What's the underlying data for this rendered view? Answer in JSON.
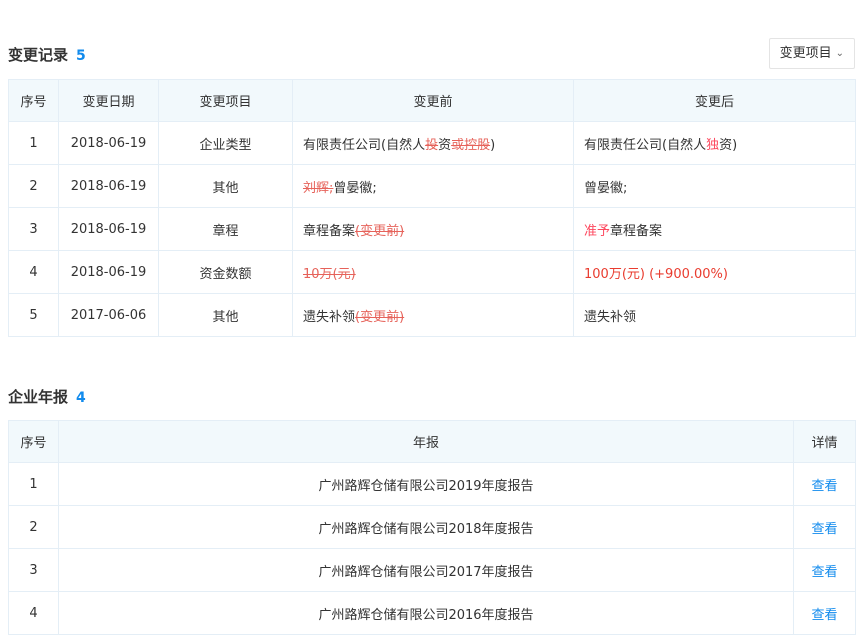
{
  "changes": {
    "title": "变更记录",
    "count": "5",
    "filter_label": "变更项目",
    "headers": [
      "序号",
      "变更日期",
      "变更项目",
      "变更前",
      "变更后"
    ],
    "rows": [
      {
        "no": "1",
        "date": "2018-06-19",
        "item": "企业类型",
        "before": [
          {
            "t": "有限责任公司(自然人",
            "s": "n"
          },
          {
            "t": "投",
            "s": "del"
          },
          {
            "t": "资",
            "s": "n"
          },
          {
            "t": "或控股",
            "s": "del"
          },
          {
            "t": ")",
            "s": "n"
          }
        ],
        "after": [
          {
            "t": "有限责任公司(自然人",
            "s": "n"
          },
          {
            "t": "独",
            "s": "add"
          },
          {
            "t": "资)",
            "s": "n"
          }
        ]
      },
      {
        "no": "2",
        "date": "2018-06-19",
        "item": "其他",
        "before": [
          {
            "t": "刘辉;",
            "s": "del"
          },
          {
            "t": "曾晏徽;",
            "s": "n"
          }
        ],
        "after": [
          {
            "t": "曾晏徽;",
            "s": "n"
          }
        ]
      },
      {
        "no": "3",
        "date": "2018-06-19",
        "item": "章程",
        "before": [
          {
            "t": "章程备案",
            "s": "n"
          },
          {
            "t": "(变更前)",
            "s": "del"
          }
        ],
        "after": [
          {
            "t": "准予",
            "s": "add"
          },
          {
            "t": "章程备案",
            "s": "n"
          }
        ]
      },
      {
        "no": "4",
        "date": "2018-06-19",
        "item": "资金数额",
        "before": [
          {
            "t": "10万(元)",
            "s": "del"
          }
        ],
        "after": [
          {
            "t": "100万(元) (+900.00%)",
            "s": "red"
          }
        ]
      },
      {
        "no": "5",
        "date": "2017-06-06",
        "item": "其他",
        "before": [
          {
            "t": "遗失补领",
            "s": "n"
          },
          {
            "t": "(变更前)",
            "s": "del"
          }
        ],
        "after": [
          {
            "t": "遗失补领",
            "s": "n"
          }
        ]
      }
    ]
  },
  "reports": {
    "title": "企业年报",
    "count": "4",
    "headers": [
      "序号",
      "年报",
      "详情"
    ],
    "rows": [
      {
        "no": "1",
        "name": "广州路辉仓储有限公司2019年度报告",
        "link": "查看"
      },
      {
        "no": "2",
        "name": "广州路辉仓储有限公司2018年度报告",
        "link": "查看"
      },
      {
        "no": "3",
        "name": "广州路辉仓储有限公司2017年度报告",
        "link": "查看"
      },
      {
        "no": "4",
        "name": "广州路辉仓储有限公司2016年度报告",
        "link": "查看"
      }
    ]
  },
  "icons": {
    "filter_dropdown": "chevron-down-icon"
  },
  "colors": {
    "accent": "#128bed",
    "header_bg": "#f2f9fc",
    "border": "#e4eef6",
    "deleted": "#e03c31",
    "added": "#fd485e"
  }
}
